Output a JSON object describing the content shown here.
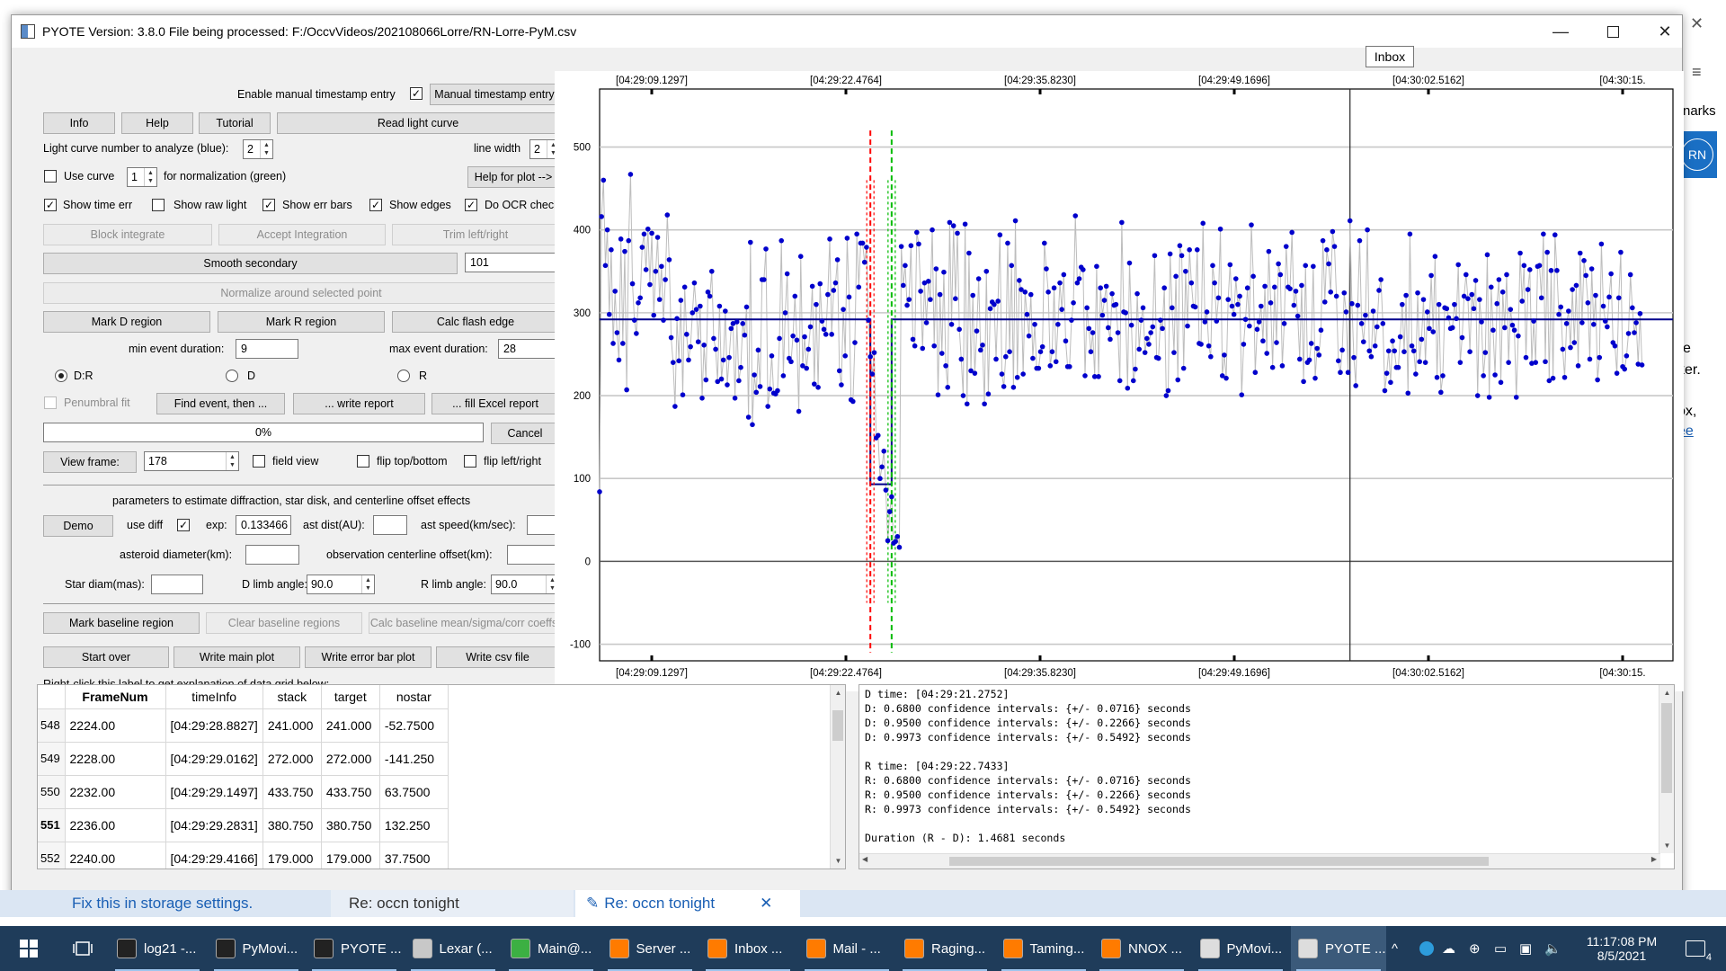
{
  "window": {
    "title": "PYOTE Version: 3.8.0  File being processed: F:/OccvVideos/202108066Lorre/RN-Lorre-PyM.csv",
    "tooltip": "Inbox"
  },
  "background": {
    "right_fragments": [
      "narks",
      "e",
      "ker.",
      "ox,",
      "ee"
    ],
    "avatar": "RN"
  },
  "controls": {
    "manual_ts_label": "Enable manual timestamp entry",
    "manual_ts_checked": "✓",
    "manual_ts_button": "Manual timestamp entry",
    "info": "Info",
    "help": "Help",
    "tutorial": "Tutorial",
    "read_light_curve": "Read light curve",
    "lc_number_label": "Light curve number to analyze (blue):",
    "lc_number": "2",
    "line_width_label": "line width",
    "line_width": "2",
    "use_curve_label": "Use curve",
    "use_curve_value": "1",
    "normalization_label": "for normalization (green)",
    "help_for_plot": "Help for plot -->",
    "checks": [
      {
        "label": "Show time err",
        "mark": "✓"
      },
      {
        "label": "Show raw light",
        "mark": ""
      },
      {
        "label": "Show err bars",
        "mark": "✓"
      },
      {
        "label": "Show edges",
        "mark": "✓"
      },
      {
        "label": "Do OCR check",
        "mark": "✓"
      }
    ],
    "block_integrate": "Block integrate",
    "accept_integration": "Accept Integration",
    "trim": "Trim left/right",
    "smooth_secondary": "Smooth secondary",
    "smooth_value": "101",
    "normalize": "Normalize around selected point",
    "mark_d": "Mark D region",
    "mark_r": "Mark R region",
    "calc_flash": "Calc flash edge",
    "min_event_label": "min event duration:",
    "min_event": "9",
    "max_event_label": "max event duration:",
    "max_event": "28",
    "radios": [
      "D:R",
      "D",
      "R"
    ],
    "penumbral": "Penumbral fit",
    "find_event": "Find event, then ...",
    "write_report": "... write report",
    "fill_excel": "... fill Excel report",
    "progress": "0%",
    "cancel": "Cancel",
    "view_frame": "View frame:",
    "view_frame_value": "178",
    "field_view": "field view",
    "flip_tb": "flip top/bottom",
    "flip_lr": "flip left/right",
    "params_title": "parameters to estimate diffraction, star disk, and centerline offset effects",
    "demo": "Demo",
    "use_diff": "use diff",
    "use_diff_mark": "✓",
    "exp_label": "exp:",
    "exp_value": "0.133466",
    "ast_dist": "ast dist(AU):",
    "ast_speed": "ast speed(km/sec):",
    "ast_diam": "asteroid diameter(km):",
    "obs_offset": "observation centerline offset(km):",
    "star_diam": "Star diam(mas):",
    "d_limb": "D limb angle:",
    "d_limb_value": "90.0",
    "r_limb": "R limb angle:",
    "r_limb_value": "90.0",
    "mark_baseline": "Mark baseline region",
    "clear_baseline": "Clear baseline regions",
    "calc_baseline": "Calc baseline mean/sigma/corr coeffs",
    "start_over": "Start over",
    "write_main": "Write main plot",
    "write_err": "Write error bar plot",
    "write_csv": "Write csv file",
    "grid_hint": "Right-click this label to get explanation of data grid below:"
  },
  "grid": {
    "columns": [
      "FrameNum",
      "timeInfo",
      "stack",
      "target",
      "nostar"
    ],
    "rows": [
      {
        "idx": "548",
        "cells": [
          "2224.00",
          "[04:29:28.8827]",
          "241.000",
          "241.000",
          "-52.7500"
        ]
      },
      {
        "idx": "549",
        "cells": [
          "2228.00",
          "[04:29:29.0162]",
          "272.000",
          "272.000",
          "-141.250"
        ]
      },
      {
        "idx": "550",
        "cells": [
          "2232.00",
          "[04:29:29.1497]",
          "433.750",
          "433.750",
          "63.7500"
        ]
      },
      {
        "idx": "551",
        "cells": [
          "2236.00",
          "[04:29:29.2831]",
          "380.750",
          "380.750",
          "132.250"
        ]
      },
      {
        "idx": "552",
        "cells": [
          "2240.00",
          "[04:29:29.4166]",
          "179.000",
          "179.000",
          "37.7500"
        ]
      }
    ]
  },
  "report_lines": [
    "D time: [04:29:21.2752]",
    "D: 0.6800 confidence intervals: {+/- 0.0716} seconds",
    "D: 0.9500 confidence intervals: {+/- 0.2266} seconds",
    "D: 0.9973 confidence intervals: {+/- 0.5492} seconds",
    "",
    "R time: [04:29:22.7433]",
    "R: 0.6800 confidence intervals: {+/- 0.0716} seconds",
    "R: 0.9500 confidence intervals: {+/- 0.2266} seconds",
    "R: 0.9973 confidence intervals: {+/- 0.5492} seconds",
    "",
    "Duration (R - D): 1.4681 seconds"
  ],
  "chart_data": {
    "type": "scatter",
    "x_tick_labels": [
      "[04:29:09.1297]",
      "[04:29:22.4764]",
      "[04:29:35.8230]",
      "[04:29:49.1696]",
      "[04:30:02.5162]",
      "[04:30:15."
    ],
    "y_ticks": [
      -100,
      0,
      100,
      200,
      300,
      400,
      500
    ],
    "ylim": [
      -120,
      570
    ],
    "x_range_frames": [
      0,
      555
    ],
    "grid": true,
    "baseline": 292,
    "event_bottom": 93,
    "d_edge_frame": 140,
    "r_edge_frame": 151,
    "cursor_frame": 388,
    "colors": {
      "points": "#0000cc",
      "connect": "#bdbdbd",
      "model": "#00008b",
      "d_edge": "#ff0000",
      "r_edge": "#00bb00"
    },
    "values": [
      84,
      416,
      460,
      357,
      400,
      298,
      376,
      263,
      326,
      276,
      243,
      389,
      263,
      374,
      207,
      387,
      467,
      335,
      291,
      275,
      312,
      318,
      379,
      395,
      352,
      401,
      334,
      396,
      297,
      350,
      391,
      316,
      356,
      291,
      340,
      418,
      364,
      270,
      240,
      187,
      293,
      242,
      315,
      201,
      331,
      274,
      243,
      259,
      300,
      336,
      304,
      265,
      308,
      197,
      261,
      219,
      325,
      320,
      350,
      269,
      256,
      217,
      308,
      220,
      243,
      302,
      213,
      246,
      281,
      287,
      197,
      289,
      218,
      234,
      287,
      273,
      307,
      174,
      385,
      165,
      225,
      204,
      255,
      211,
      340,
      340,
      377,
      187,
      208,
      248,
      203,
      202,
      206,
      269,
      387,
      224,
      300,
      347,
      245,
      241,
      272,
      320,
      267,
      181,
      368,
      236,
      271,
      233,
      256,
      283,
      332,
      214,
      310,
      210,
      335,
      290,
      280,
      274,
      322,
      389,
      274,
      327,
      336,
      364,
      230,
      213,
      304,
      248,
      390,
      319,
      195,
      193,
      264,
      395,
      331,
      384,
      384,
      361,
      379,
      291,
      247,
      226,
      252,
      149,
      152,
      100,
      114,
      133,
      86,
      25,
      60,
      78,
      22,
      24,
      30,
      17,
      380,
      333,
      357,
      309,
      316,
      381,
      268,
      260,
      397,
      383,
      326,
      257,
      336,
      288,
      338,
      316,
      400,
      260,
      353,
      201,
      322,
      251,
      349,
      236,
      210,
      409,
      286,
      405,
      317,
      396,
      280,
      244,
      200,
      407,
      190,
      372,
      230,
      321,
      227,
      278,
      341,
      255,
      261,
      190,
      350,
      202,
      305,
      313,
      310,
      244,
      314,
      394,
      226,
      211,
      247,
      384,
      253,
      357,
      210,
      411,
      222,
      339,
      328,
      226,
      325,
      298,
      272,
      322,
      245,
      286,
      233,
      233,
      253,
      259,
      384,
      353,
      325,
      236,
      253,
      330,
      241,
      286,
      336,
      304,
      346,
      266,
      235,
      235,
      291,
      312,
      417,
      336,
      341,
      355,
      352,
      224,
      306,
      281,
      253,
      276,
      223,
      356,
      223,
      330,
      297,
      315,
      332,
      282,
      268,
      323,
      309,
      310,
      276,
      218,
      409,
      301,
      300,
      209,
      360,
      285,
      218,
      232,
      323,
      256,
      291,
      306,
      252,
      269,
      262,
      276,
      283,
      369,
      246,
      245,
      291,
      281,
      330,
      200,
      206,
      371,
      306,
      252,
      344,
      219,
      381,
      369,
      233,
      350,
      284,
      376,
      336,
      308,
      307,
      376,
      263,
      262,
      408,
      289,
      301,
      260,
      247,
      357,
      336,
      290,
      318,
      401,
      224,
      249,
      221,
      316,
      358,
      308,
      298,
      341,
      310,
      320,
      201,
      262,
      292,
      330,
      284,
      406,
      344,
      228,
      280,
      289,
      308,
      266,
      332,
      251,
      374,
      312,
      234,
      331,
      264,
      359,
      346,
      236,
      287,
      380,
      331,
      329,
      397,
      309,
      326,
      296,
      244,
      333,
      217,
      357,
      240,
      243,
      263,
      356,
      221,
      257,
      249,
      279,
      387,
      313,
      376,
      359,
      325,
      398,
      380,
      320,
      242,
      228,
      255,
      324,
      301,
      228,
      411,
      311,
      246,
      212,
      309,
      387,
      287,
      265,
      297,
      400,
      254,
      247,
      302,
      260,
      283,
      327,
      340,
      287,
      206,
      227,
      254,
      216,
      266,
      254,
      234,
      234,
      271,
      310,
      253,
      321,
      203,
      395,
      260,
      254,
      226,
      324,
      241,
      268,
      316,
      240,
      301,
      281,
      345,
      277,
      368,
      222,
      310,
      204,
      224,
      306,
      305,
      294,
      281,
      282,
      310,
      293,
      358,
      240,
      270,
      320,
      346,
      317,
      253,
      322,
      305,
      339,
      200,
      316,
      289,
      224,
      252,
      370,
      198,
      331,
      279,
      225,
      311,
      340,
      216,
      325,
      282,
      346,
      240,
      304,
      285,
      279,
      198,
      272,
      372,
      314,
      357,
      246,
      328,
      352,
      239,
      290,
      240,
      356,
      357,
      318,
      395,
      241,
      373,
      218,
      351,
      221,
      394,
      351,
      298,
      307,
      256,
      222,
      287,
      302,
      258,
      328,
      264,
      333,
      236,
      372,
      288,
      363,
      345,
      312,
      244,
      353,
      286,
      321,
      219,
      246,
      383,
      308,
      290,
      283,
      319,
      347,
      264,
      260,
      227,
      318,
      373,
      235,
      232,
      248,
      275,
      346,
      306,
      276,
      288,
      238,
      299,
      237
    ]
  },
  "browser_strip": {
    "storage": "Fix this in storage settings.",
    "tab1": "Re: occn tonight",
    "tab2": "Re: occn tonight",
    "close": "✕"
  },
  "taskbar": {
    "items": [
      {
        "label": "log21 -...",
        "color": "#222"
      },
      {
        "label": "PyMovi...",
        "color": "#222"
      },
      {
        "label": "PYOTE ...",
        "color": "#222"
      },
      {
        "label": "Lexar (...",
        "color": "#c8c8c8"
      },
      {
        "label": "Main@...",
        "color": "#3cb043"
      },
      {
        "label": "Server ...",
        "color": "#ff7b00"
      },
      {
        "label": "Inbox ...",
        "color": "#ff7b00"
      },
      {
        "label": "Mail - ...",
        "color": "#ff7b00"
      },
      {
        "label": "Raging...",
        "color": "#ff7b00"
      },
      {
        "label": "Taming...",
        "color": "#ff7b00"
      },
      {
        "label": "NNOX ...",
        "color": "#ff7b00"
      },
      {
        "label": "PyMovi...",
        "color": "#dddddd"
      },
      {
        "label": "PYOTE ...",
        "color": "#dddddd"
      }
    ],
    "time": "11:17:08 PM",
    "date": "8/5/2021",
    "notif_count": "4"
  }
}
